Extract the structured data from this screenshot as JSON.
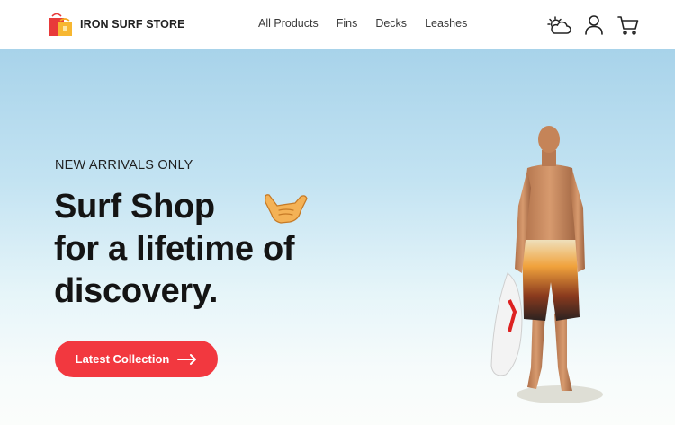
{
  "header": {
    "brand_name": "IRON SURF STORE",
    "nav_links": [
      "All Products",
      "Fins",
      "Decks",
      "Leashes"
    ],
    "icons": [
      "weather-icon",
      "user-icon",
      "cart-icon"
    ]
  },
  "hero": {
    "eyebrow": "NEW ARRIVALS ONLY",
    "headline_lines": [
      "Surf Shop",
      "for a lifetime of",
      "discovery."
    ],
    "cta_label": "Latest Collection",
    "decor_icon": "shaka-hand-icon"
  },
  "colors": {
    "accent": "#f2383f",
    "hero_top": "#a8d3ea",
    "hero_bottom": "#fbfdfb",
    "text": "#141414"
  }
}
